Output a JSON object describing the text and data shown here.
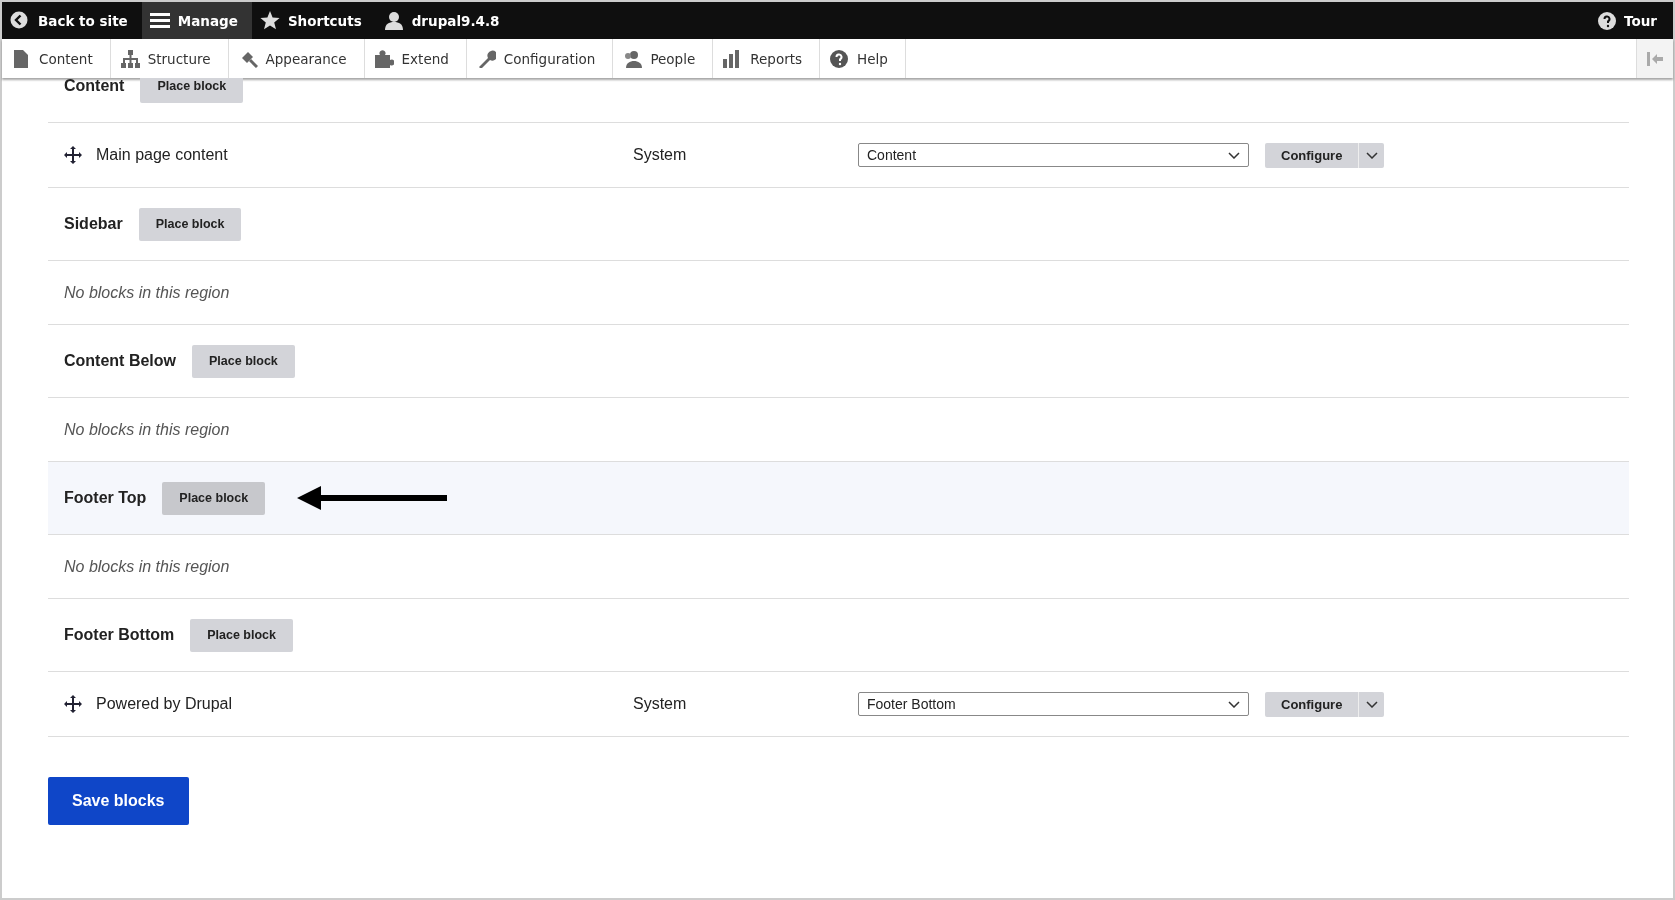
{
  "toolbar": {
    "items": [
      {
        "kind": "back",
        "label": "Back to site",
        "selected": false
      },
      {
        "kind": "menu",
        "label": "Manage",
        "selected": true
      },
      {
        "kind": "star",
        "label": "Shortcuts",
        "selected": false
      },
      {
        "kind": "user",
        "label": "drupal9.4.8",
        "selected": false
      }
    ],
    "tour": "Tour"
  },
  "tray": [
    {
      "kind": "page",
      "label": "Content"
    },
    {
      "kind": "tree",
      "label": "Structure"
    },
    {
      "kind": "brush",
      "label": "Appearance"
    },
    {
      "kind": "puzzle",
      "label": "Extend"
    },
    {
      "kind": "wrench",
      "label": "Configuration"
    },
    {
      "kind": "people",
      "label": "People"
    },
    {
      "kind": "bars",
      "label": "Reports"
    },
    {
      "kind": "help",
      "label": "Help"
    }
  ],
  "regions": [
    {
      "name": "Content",
      "button": "Place block",
      "highlighted": false,
      "pointer": false,
      "blocks": [
        {
          "name": "Main page content",
          "category": "System",
          "region": "Content",
          "configure": "Configure"
        }
      ]
    },
    {
      "name": "Sidebar",
      "button": "Place block",
      "highlighted": false,
      "pointer": false,
      "empty": "No blocks in this region"
    },
    {
      "name": "Content Below",
      "button": "Place block",
      "highlighted": false,
      "pointer": false,
      "empty": "No blocks in this region"
    },
    {
      "name": "Footer Top",
      "button": "Place block",
      "highlighted": true,
      "pointer": true,
      "empty": "No blocks in this region"
    },
    {
      "name": "Footer Bottom",
      "button": "Place block",
      "highlighted": false,
      "pointer": false,
      "blocks": [
        {
          "name": "Powered by Drupal",
          "category": "System",
          "region": "Footer Bottom",
          "configure": "Configure"
        }
      ]
    }
  ],
  "save": "Save blocks"
}
